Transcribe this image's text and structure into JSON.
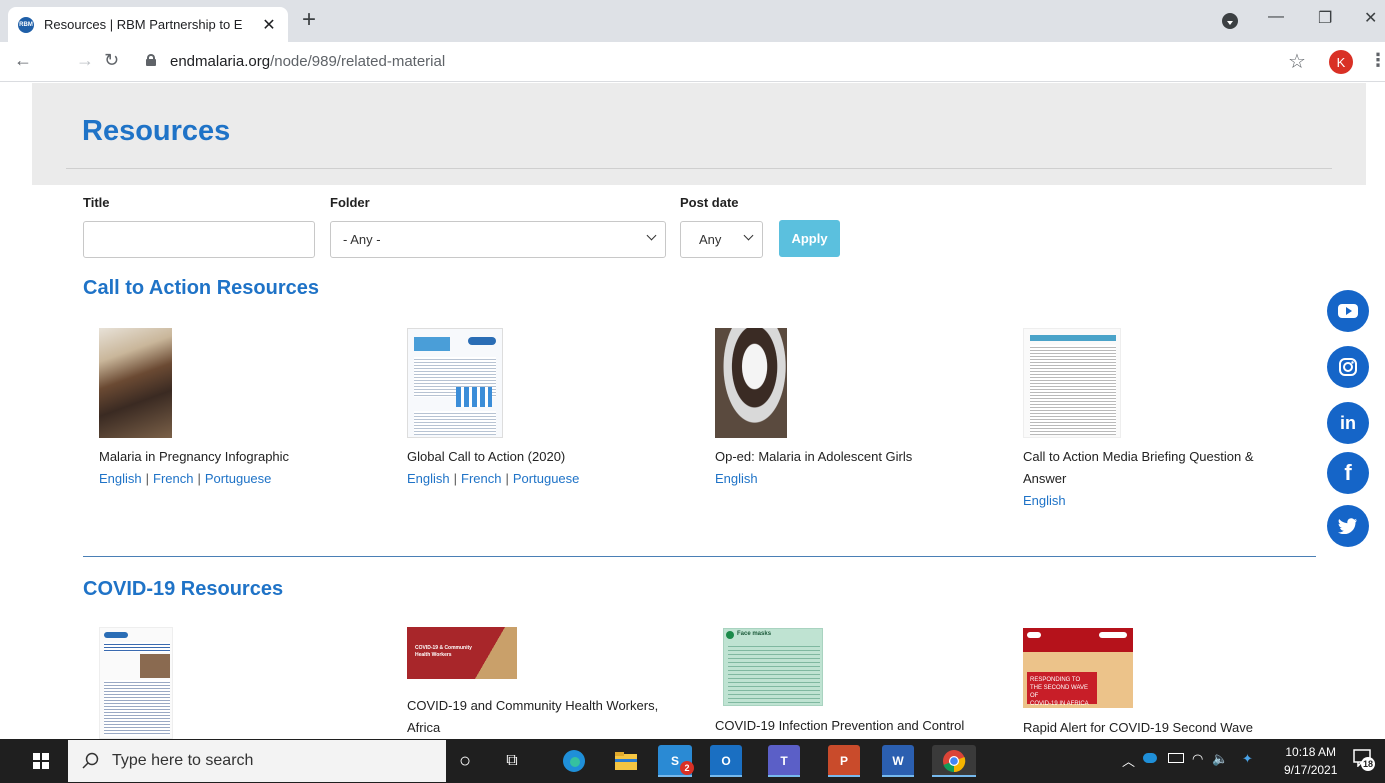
{
  "browser": {
    "tab_title": "Resources | RBM Partnership to E",
    "favicon_text": "RBM",
    "url_domain": "endmalaria.org",
    "url_path": "/node/989/related-material",
    "profile_initial": "K"
  },
  "page": {
    "heading": "Resources",
    "filters": {
      "title_label": "Title",
      "title_value": "",
      "folder_label": "Folder",
      "folder_value": "- Any -",
      "postdate_label": "Post date",
      "postdate_value": "Any",
      "apply_label": "Apply"
    },
    "sections": [
      {
        "title": "Call to Action Resources",
        "items": [
          {
            "title": "Malaria in Pregnancy Infographic",
            "links": [
              "English",
              "French",
              "Portuguese"
            ]
          },
          {
            "title": "Global Call to Action (2020)",
            "links": [
              "English",
              "French",
              "Portuguese"
            ]
          },
          {
            "title": "Op-ed: Malaria in Adolescent Girls",
            "links": [
              "English"
            ]
          },
          {
            "title_line1": "Call to Action Media Briefing Question &",
            "title_line2": "Answer",
            "links": [
              "English"
            ]
          }
        ]
      },
      {
        "title": "COVID-19 Resources",
        "items": [
          {
            "title": ""
          },
          {
            "title_line1": "COVID-19 and Community Health Workers,",
            "title_line2": "Africa",
            "thumb_line1": "COVID-19 & Community",
            "thumb_line2": "Health Workers"
          },
          {
            "title": "COVID-19 Infection Prevention and Control",
            "thumb_label": "Face masks"
          },
          {
            "title": "Rapid Alert for COVID-19 Second Wave",
            "thumb_line1": "RESPONDING TO",
            "thumb_line2": "THE SECOND WAVE OF",
            "thumb_line3": "COVID-19 IN AFRICA"
          }
        ]
      }
    ],
    "social": [
      "youtube-icon",
      "instagram-icon",
      "linkedin-icon",
      "facebook-icon",
      "twitter-icon"
    ]
  },
  "taskbar": {
    "search_placeholder": "Type here to search",
    "time": "10:18 AM",
    "date": "9/17/2021",
    "notification_count": "18",
    "skype_badge": "2"
  },
  "colors": {
    "brand_blue": "#1f73c7",
    "apply_button": "#5bc0de",
    "social_blue": "#1565c8"
  }
}
